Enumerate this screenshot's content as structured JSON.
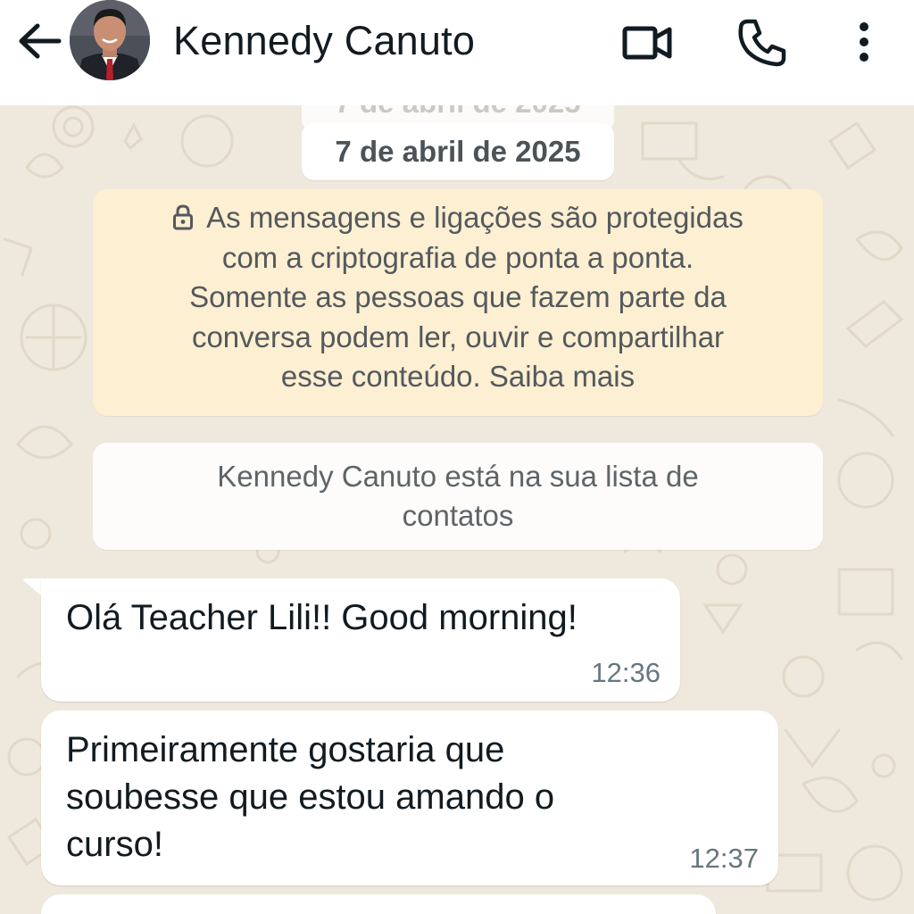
{
  "header": {
    "contact_name": "Kennedy Canuto",
    "icons": {
      "back": "arrow-back-icon",
      "video": "video-call-icon",
      "phone": "phone-call-icon",
      "menu": "more-vertical-icon"
    }
  },
  "chat": {
    "date_chip": "7 de abril de 2025",
    "encryption_notice": {
      "lines": [
        "As mensagens e ligações são protegidas",
        "com a criptografia de ponta a ponta.",
        "Somente as pessoas que fazem parte da",
        "conversa podem ler, ouvir e compartilhar",
        "esse conteúdo. Saiba mais"
      ],
      "icon": "lock-icon"
    },
    "contact_notice": {
      "lines": [
        "Kennedy Canuto está na sua lista de",
        "contatos"
      ]
    },
    "messages": [
      {
        "lines": [
          "Olá Teacher Lili!! Good morning!"
        ],
        "time": "12:36"
      },
      {
        "lines": [
          "Primeiramente gostaria que",
          "soubesse que estou amando o",
          "curso!"
        ],
        "time": "12:37"
      }
    ]
  },
  "colors": {
    "header_bg": "#ffffff",
    "wallpaper": "#efe8dd",
    "encryption_bg": "#fcefd2",
    "bubble_in": "#ffffff",
    "timestamp": "#667781"
  }
}
